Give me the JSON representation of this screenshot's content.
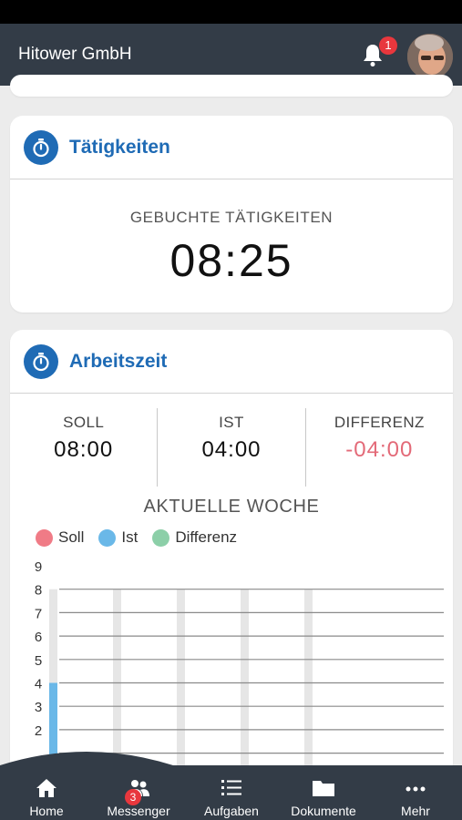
{
  "header": {
    "title": "Hitower GmbH",
    "notification_count": "1"
  },
  "activities": {
    "title": "Tätigkeiten",
    "label": "GEBUCHTE TÄTIGKEITEN",
    "value": "08:25"
  },
  "worktime": {
    "title": "Arbeitszeit",
    "stats": [
      {
        "label": "SOLL",
        "value": "08:00"
      },
      {
        "label": "IST",
        "value": "04:00"
      },
      {
        "label": "DIFFERENZ",
        "value": "-04:00"
      }
    ]
  },
  "chart_data": {
    "type": "bar",
    "title": "AKTUELLE WOCHE",
    "legend": [
      "Soll",
      "Ist",
      "Differenz"
    ],
    "colors": {
      "Soll": "#f07b86",
      "Ist": "#6ab8e8",
      "Differenz": "#8ccfa8"
    },
    "y_ticks": [
      9,
      8,
      7,
      6,
      5,
      4,
      3,
      2
    ],
    "ylim": [
      0,
      9
    ],
    "series": [
      {
        "name": "Soll",
        "values": [
          8,
          8,
          8,
          8,
          8
        ]
      },
      {
        "name": "Ist",
        "values": [
          4,
          0,
          0,
          0,
          0
        ]
      }
    ]
  },
  "nav": {
    "items": [
      {
        "label": "Home",
        "icon": "home-icon"
      },
      {
        "label": "Messenger",
        "icon": "people-icon",
        "badge": "3"
      },
      {
        "label": "Aufgaben",
        "icon": "list-icon"
      },
      {
        "label": "Dokumente",
        "icon": "folder-icon"
      },
      {
        "label": "Mehr",
        "icon": "more-icon"
      }
    ]
  }
}
